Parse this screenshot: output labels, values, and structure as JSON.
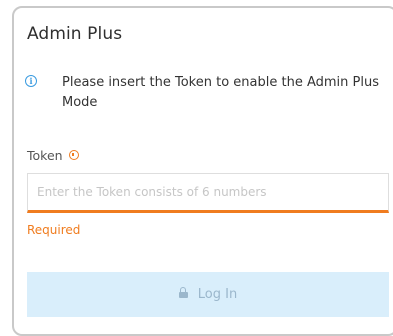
{
  "dialog": {
    "title": "Admin Plus",
    "info_icon": "info-icon",
    "info_text": "Please insert the Token to enable the Admin Plus Mode",
    "token_label": "Token",
    "required_icon": "required-indicator-icon",
    "token_placeholder": "Enter the Token consists of 6 numbers",
    "token_value": "",
    "validation_message": "Required",
    "login_icon": "lock-icon",
    "login_label": "Log In"
  },
  "colors": {
    "accent_orange": "#f07c1f",
    "info_blue": "#3a9be0",
    "button_bg_disabled": "#d9eefb",
    "button_text_disabled": "#9bb7cc",
    "border": "#c9c9c9"
  }
}
